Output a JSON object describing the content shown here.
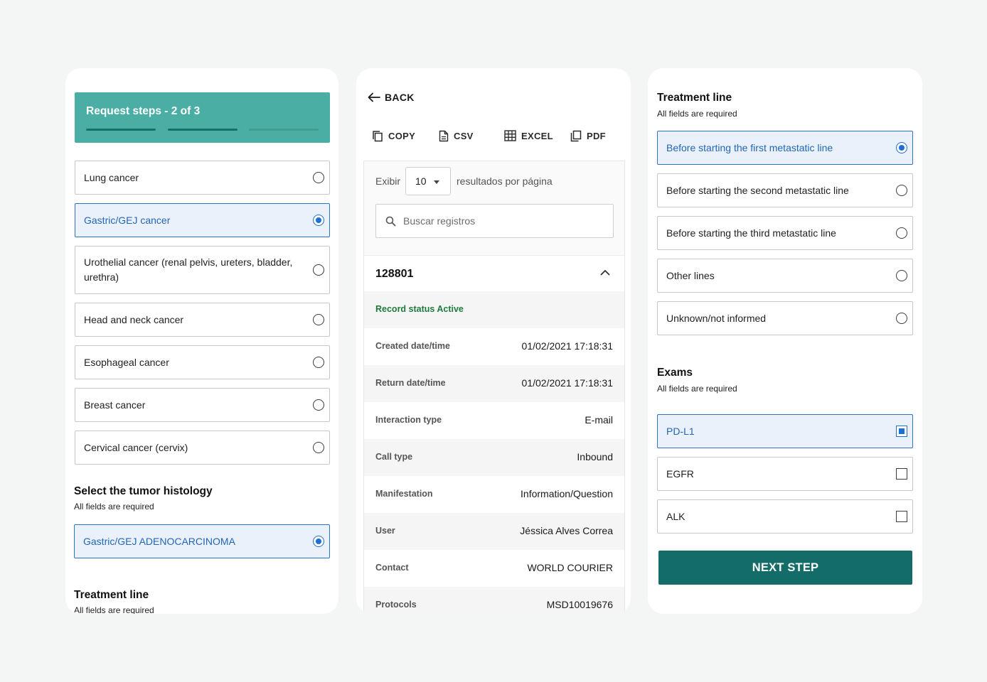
{
  "request_card": {
    "steps_title": "Request steps - 2 of 3",
    "cancer_options": [
      {
        "label": "Lung cancer",
        "selected": false
      },
      {
        "label": "Gastric/GEJ cancer",
        "selected": true
      },
      {
        "label": "Urothelial cancer (renal pelvis, ureters, bladder,",
        "label2": "urethra)",
        "selected": false
      },
      {
        "label": "Head and neck cancer",
        "selected": false
      },
      {
        "label": "Esophageal cancer",
        "selected": false
      },
      {
        "label": "Breast cancer",
        "selected": false
      },
      {
        "label": "Cervical cancer (cervix)",
        "selected": false
      }
    ],
    "histology_title": "Select the tumor histology",
    "histology_sub": "All fields are required",
    "histology_option": "Gastric/GEJ ADENOCARCINOMA",
    "treatment_title": "Treatment line",
    "treatment_sub": "All fields are required"
  },
  "records_card": {
    "back_label": "BACK",
    "toolbar": {
      "copy": "COPY",
      "csv": "CSV",
      "excel": "EXCEL",
      "pdf": "PDF"
    },
    "show_label": "Exibir",
    "page_size": "10",
    "per_page_label": "resultados por página",
    "search_placeholder": "Buscar registros",
    "record": {
      "id": "128801",
      "status": "Record status Active",
      "rows": [
        {
          "key": "Created date/time",
          "value": "01/02/2021 17:18:31"
        },
        {
          "key": "Return date/time",
          "value": "01/02/2021 17:18:31"
        },
        {
          "key": "Interaction type",
          "value": "E-mail"
        },
        {
          "key": "Call type",
          "value": "Inbound"
        },
        {
          "key": "Manifestation",
          "value": "Information/Question"
        },
        {
          "key": "User",
          "value": "Jéssica Alves Correa"
        },
        {
          "key": "Contact",
          "value": "WORLD COURIER"
        },
        {
          "key": "Protocols",
          "value": "MSD10019676"
        }
      ]
    }
  },
  "treatment_card": {
    "title": "Treatment line",
    "sub": "All fields are required",
    "options": [
      {
        "label": "Before starting the first metastatic line",
        "selected": true
      },
      {
        "label": "Before starting the second metastatic line",
        "selected": false
      },
      {
        "label": "Before starting the third metastatic line",
        "selected": false
      },
      {
        "label": "Other lines",
        "selected": false
      },
      {
        "label": "Unknown/not informed",
        "selected": false
      }
    ],
    "exams_title": "Exams",
    "exams_sub": "All fields are required",
    "exams": [
      {
        "label": "PD-L1",
        "checked": true
      },
      {
        "label": "EGFR",
        "checked": false
      },
      {
        "label": "ALK",
        "checked": false
      }
    ],
    "next_label": "NEXT STEP"
  },
  "colors": {
    "header_teal": "#4aaea5",
    "button_teal": "#136c67",
    "selected_blue": "#2166b8",
    "selected_bg": "#eaf1fb",
    "status_green": "#1f7a3b"
  }
}
